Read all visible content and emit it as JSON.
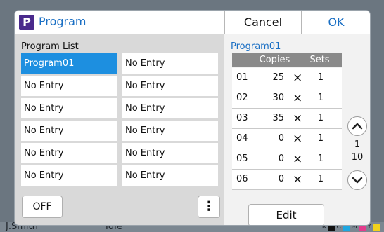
{
  "colors": {
    "accent": "#1a6fc4",
    "selected": "#1d8fe0",
    "logo": "#4a2a8c"
  },
  "background": {
    "user_name": "J.Smith",
    "status": "Idle",
    "ink_labels": [
      "K",
      "C",
      "M",
      "Y"
    ]
  },
  "dialog": {
    "logo_letter": "P",
    "title": "Program",
    "cancel_label": "Cancel",
    "ok_label": "OK",
    "list_label": "Program List",
    "list_items": [
      {
        "label": "Program01",
        "selected": true
      },
      {
        "label": "No Entry"
      },
      {
        "label": "No Entry"
      },
      {
        "label": "No Entry"
      },
      {
        "label": "No Entry"
      },
      {
        "label": "No Entry"
      },
      {
        "label": "No Entry"
      },
      {
        "label": "No Entry"
      },
      {
        "label": "No Entry"
      },
      {
        "label": "No Entry"
      },
      {
        "label": "No Entry"
      },
      {
        "label": "No Entry"
      }
    ],
    "off_label": "OFF",
    "more_icon": "vertical-ellipsis-icon",
    "detail": {
      "program_name": "Program01",
      "col_copies": "Copies",
      "col_sets": "Sets",
      "rows": [
        {
          "no": "01",
          "copies": "25",
          "sets": "1"
        },
        {
          "no": "02",
          "copies": "30",
          "sets": "1"
        },
        {
          "no": "03",
          "copies": "35",
          "sets": "1"
        },
        {
          "no": "04",
          "copies": "0",
          "sets": "1"
        },
        {
          "no": "05",
          "copies": "0",
          "sets": "1"
        },
        {
          "no": "06",
          "copies": "0",
          "sets": "1"
        }
      ],
      "times_symbol": "×",
      "page_current": "1",
      "page_total": "10",
      "edit_label": "Edit"
    }
  }
}
